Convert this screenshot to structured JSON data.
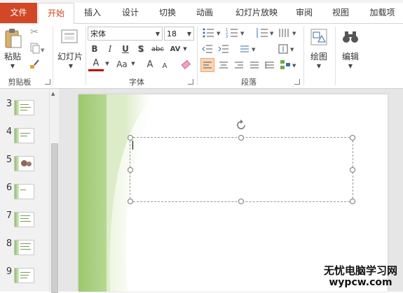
{
  "tabs": {
    "file": "文件",
    "items": [
      "开始",
      "插入",
      "设计",
      "切换",
      "动画",
      "幻灯片放映",
      "审阅",
      "视图",
      "加载项"
    ]
  },
  "clipboard": {
    "paste_label": "粘贴",
    "group_label": "剪贴板"
  },
  "slides_group": {
    "new_slide_label": "幻灯片"
  },
  "font": {
    "name": "宋体",
    "size": "18",
    "group_label": "字体",
    "bold": "B",
    "italic": "I",
    "underline": "U",
    "shadow": "S",
    "strike": "abc",
    "spacing": "AV",
    "color_a": "A",
    "case": "Aa",
    "grow": "A",
    "shrink": "A"
  },
  "paragraph": {
    "group_label": "段落"
  },
  "drawing": {
    "label": "绘图"
  },
  "editing": {
    "label": "编辑"
  },
  "thumbnails": {
    "numbers": [
      "3",
      "4",
      "5",
      "6",
      "7",
      "8",
      "9"
    ]
  },
  "watermark": {
    "line1": "无忧电脑学习网",
    "line2": "wypcw.com"
  },
  "colors": {
    "file_tab": "#d24726",
    "accent_green": "#8fc069",
    "font_color_red": "#c00000",
    "align_active": "#fbd5b5"
  }
}
